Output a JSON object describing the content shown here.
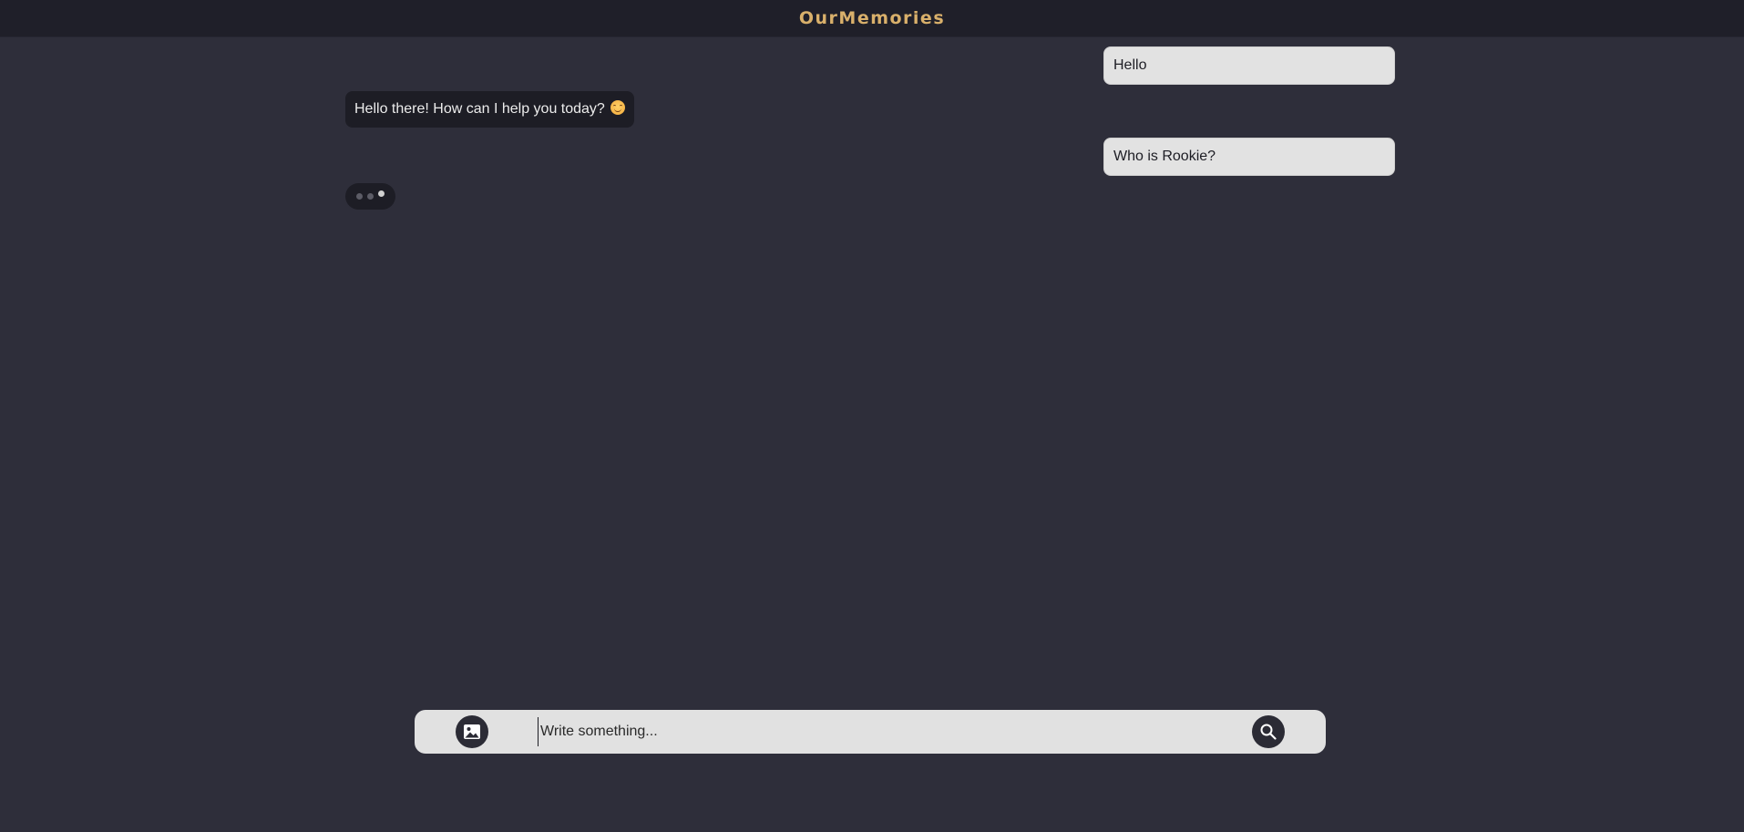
{
  "header": {
    "brand": "OurMemories",
    "brand_color": "#d9b06b"
  },
  "messages": [
    {
      "role": "user",
      "text": "Hello"
    },
    {
      "role": "bot",
      "text": "Hello there! How can I help you today?",
      "emoji": "smiling-face-emoji"
    },
    {
      "role": "user",
      "text": "Who is Rookie?"
    }
  ],
  "typing_indicator": {
    "visible": true,
    "dots": 3
  },
  "composer": {
    "placeholder": "Write something...",
    "value": "",
    "left_icon": "image-icon",
    "right_icon": "search-icon"
  },
  "colors": {
    "background": "#2e2e3a",
    "topbar": "#1f1f29",
    "user_bubble": "#e2e2e2",
    "bot_bubble": "#1d1d25",
    "composer": "#e1e1e1"
  }
}
